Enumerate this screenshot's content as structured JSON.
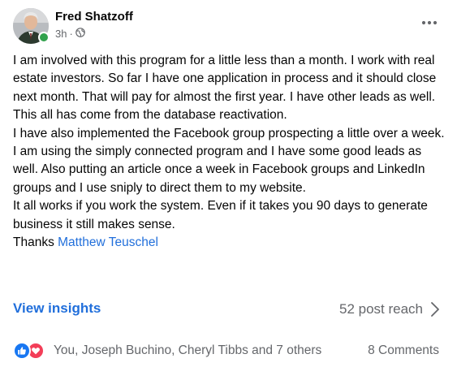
{
  "post": {
    "author": "Fred Shatzoff",
    "time": "3h",
    "separator": "·",
    "audience_icon": "globe-icon",
    "paragraphs": [
      "I am involved with this program for a little less than a month.  I work with real estate investors.  So far I have one application in process and it should close next month.  That will pay for almost the first year.  I have other leads as well.  This all has come from the database reactivation.",
      "I have also implemented the Facebook group prospecting a little over a week.  I am using the simply connected program and I have some good leads as well.  Also putting an article once a week in Facebook groups and LinkedIn groups and I use sniply to direct them to my website.",
      "It all works if you work the system.  Even if it takes you 90 days to generate business it still makes sense."
    ],
    "thanks_text": "Thanks ",
    "mention": "Matthew Teuschel"
  },
  "insights": {
    "view_label": "View insights",
    "reach": "52 post reach"
  },
  "reactions": {
    "names": "You, Joseph Buchino, Cheryl Tibbs and 7 others",
    "comments": "8 Comments"
  },
  "colors": {
    "link_blue": "#216fdb",
    "secondary_text": "#65676b",
    "like_blue": "#1877f2",
    "love_red": "#f33e58",
    "online_green": "#31a24c"
  }
}
